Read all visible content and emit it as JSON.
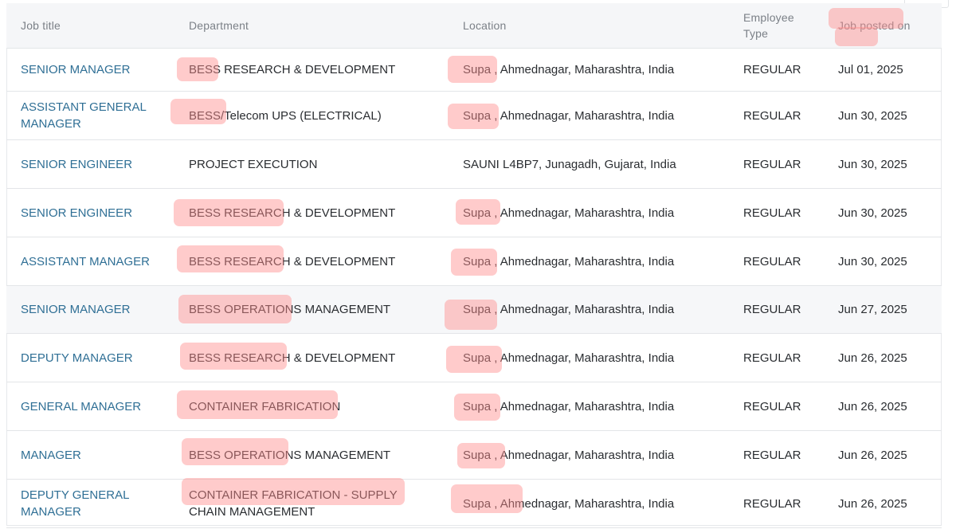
{
  "table": {
    "headers": {
      "title": "Job title",
      "department": "Department",
      "location": "Location",
      "type": "Employee Type",
      "posted": "Job posted on"
    },
    "rows": [
      {
        "title": "SENIOR MANAGER",
        "department": "BESS RESEARCH & DEVELOPMENT",
        "location": "Supa , Ahmednagar, Maharashtra, India",
        "type": "REGULAR",
        "posted": "Jul 01, 2025"
      },
      {
        "title": "ASSISTANT GENERAL MANAGER",
        "department": "BESS/Telecom UPS (ELECTRICAL)",
        "location": "Supa , Ahmednagar, Maharashtra, India",
        "type": "REGULAR",
        "posted": "Jun 30, 2025"
      },
      {
        "title": "SENIOR ENGINEER",
        "department": "PROJECT EXECUTION",
        "location": "SAUNI L4BP7, Junagadh, Gujarat, India",
        "type": "REGULAR",
        "posted": "Jun 30, 2025"
      },
      {
        "title": "SENIOR ENGINEER",
        "department": "BESS RESEARCH & DEVELOPMENT",
        "location": "Supa , Ahmednagar, Maharashtra, India",
        "type": "REGULAR",
        "posted": "Jun 30, 2025"
      },
      {
        "title": "ASSISTANT MANAGER",
        "department": "BESS RESEARCH & DEVELOPMENT",
        "location": "Supa , Ahmednagar, Maharashtra, India",
        "type": "REGULAR",
        "posted": "Jun 30, 2025"
      },
      {
        "title": "SENIOR MANAGER",
        "department": "BESS OPERATIONS MANAGEMENT",
        "location": "Supa , Ahmednagar, Maharashtra, India",
        "type": "REGULAR",
        "posted": "Jun 27, 2025"
      },
      {
        "title": "DEPUTY MANAGER",
        "department": "BESS RESEARCH & DEVELOPMENT",
        "location": "Supa , Ahmednagar, Maharashtra, India",
        "type": "REGULAR",
        "posted": "Jun 26, 2025"
      },
      {
        "title": "GENERAL MANAGER",
        "department": "CONTAINER FABRICATION",
        "location": "Supa , Ahmednagar, Maharashtra, India",
        "type": "REGULAR",
        "posted": "Jun 26, 2025"
      },
      {
        "title": "MANAGER",
        "department": "BESS OPERATIONS MANAGEMENT",
        "location": "Supa , Ahmednagar, Maharashtra, India",
        "type": "REGULAR",
        "posted": "Jun 26, 2025"
      },
      {
        "title": "DEPUTY GENERAL MANAGER",
        "department": "CONTAINER FABRICATION - SUPPLY CHAIN MANAGEMENT",
        "location": "Supa , Ahmednagar, Maharashtra, India",
        "type": "REGULAR",
        "posted": "Jun 26, 2025"
      }
    ]
  },
  "colors": {
    "link": "#2f6f95",
    "header_bg": "#f5f6f8",
    "highlight": "#ff8c8c"
  }
}
